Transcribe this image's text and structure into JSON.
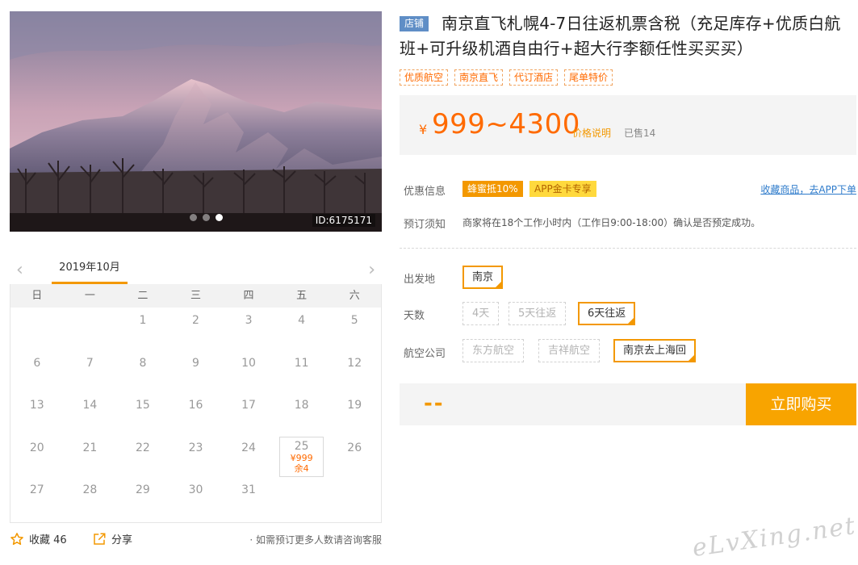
{
  "gallery": {
    "image_id": "ID:6175171",
    "slides": 3,
    "active_slide": 3
  },
  "calendar": {
    "month_label": "2019年10月",
    "prev_icon": "chevron-left-icon",
    "next_icon": "chevron-right-icon",
    "weekdays": [
      "日",
      "一",
      "二",
      "三",
      "四",
      "五",
      "六"
    ],
    "leading_blanks": 2,
    "days": [
      "1",
      "2",
      "3",
      "4",
      "5",
      "6",
      "7",
      "8",
      "9",
      "10",
      "11",
      "12",
      "13",
      "14",
      "15",
      "16",
      "17",
      "18",
      "19",
      "20",
      "21",
      "22",
      "23",
      "24",
      "25",
      "26",
      "27",
      "28",
      "29",
      "30",
      "31"
    ],
    "available": {
      "25": {
        "price": "¥999",
        "stock": "余4"
      }
    }
  },
  "actions": {
    "favorite_icon": "star-icon",
    "favorite_label": "收藏 46",
    "share_icon": "share-icon",
    "share_label": "分享",
    "note": "· 如需预订更多人数请咨询客服"
  },
  "product": {
    "shop_tag": "店铺",
    "title": "南京直飞札幌4-7日往返机票含税（充足库存+优质白航班+可升级机酒自由行+超大行李额任性买买买）",
    "tags": [
      "优质航空",
      "南京直飞",
      "代订酒店",
      "尾单特价"
    ]
  },
  "price": {
    "currency": "¥",
    "range": "999~4300",
    "explain_link": "价格说明",
    "sold": "已售14"
  },
  "promo": {
    "label": "优惠信息",
    "badge_discount": "蜂蜜抵10%",
    "badge_app": "APP金卡专享",
    "app_link": "收藏商品，去APP下单"
  },
  "booking": {
    "label": "预订须知",
    "notice": "商家将在18个工作小时内（工作日9:00-18:00）确认是否预定成功。"
  },
  "options": {
    "departure": {
      "label": "出发地",
      "items": [
        "南京"
      ],
      "selected": "南京"
    },
    "days": {
      "label": "天数",
      "items": [
        "4天",
        "5天往返",
        "6天往返"
      ],
      "selected": "6天往返"
    },
    "airline": {
      "label": "航空公司",
      "items": [
        "东方航空",
        "吉祥航空",
        "南京去上海回"
      ],
      "selected": "南京去上海回"
    }
  },
  "purchase": {
    "total": "--",
    "buy_label": "立即购买"
  },
  "watermark": "eLvXing.net",
  "colors": {
    "accent": "#f39800",
    "price": "#ff6a00",
    "shop_tag": "#5f8ec6",
    "link": "#2e7bcb"
  }
}
